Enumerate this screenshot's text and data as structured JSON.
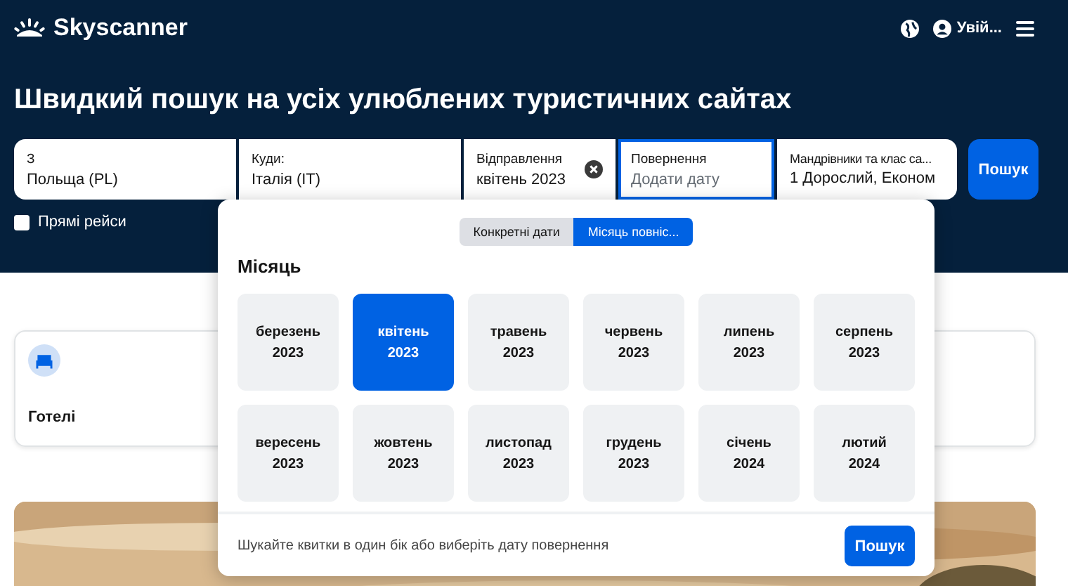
{
  "header": {
    "logo": "Skyscanner",
    "login": "Увій..."
  },
  "headline": "Швидкий пошук на усіх улюблених туристичних сайтах",
  "search_fields": [
    {
      "label": "З",
      "value": "Польща (PL)",
      "focused": false,
      "clearable": false
    },
    {
      "label": "Куди:",
      "value": "Італія (IT)",
      "focused": false,
      "clearable": false
    },
    {
      "label": "Відправлення",
      "value": "квітень 2023",
      "focused": false,
      "clearable": true
    },
    {
      "label": "Повернення",
      "placeholder": "Додати дату",
      "focused": true,
      "clearable": false
    },
    {
      "label": "Мандрівники та клас са...",
      "value": "1 Дорослий, Економ",
      "focused": false,
      "clearable": false
    }
  ],
  "search_button": "Пошук",
  "direct_flights": {
    "label": "Прямі рейси",
    "checked": false
  },
  "hotels_card": {
    "label": "Готелі"
  },
  "date_popup": {
    "tabs": [
      {
        "label": "Конкретні дати",
        "selected": false
      },
      {
        "label": "Місяць повніс...",
        "selected": true
      }
    ],
    "title": "Місяць",
    "months": [
      {
        "month": "березень",
        "year": "2023",
        "selected": false
      },
      {
        "month": "квітень",
        "year": "2023",
        "selected": true
      },
      {
        "month": "травень",
        "year": "2023",
        "selected": false
      },
      {
        "month": "червень",
        "year": "2023",
        "selected": false
      },
      {
        "month": "липень",
        "year": "2023",
        "selected": false
      },
      {
        "month": "серпень",
        "year": "2023",
        "selected": false
      },
      {
        "month": "вересень",
        "year": "2023",
        "selected": false
      },
      {
        "month": "жовтень",
        "year": "2023",
        "selected": false
      },
      {
        "month": "листопад",
        "year": "2023",
        "selected": false
      },
      {
        "month": "грудень",
        "year": "2023",
        "selected": false
      },
      {
        "month": "січень",
        "year": "2024",
        "selected": false
      },
      {
        "month": "лютий",
        "year": "2024",
        "selected": false
      }
    ],
    "hint": "Шукайте квитки в один бік або виберіть дату повернення",
    "button": "Пошук"
  }
}
